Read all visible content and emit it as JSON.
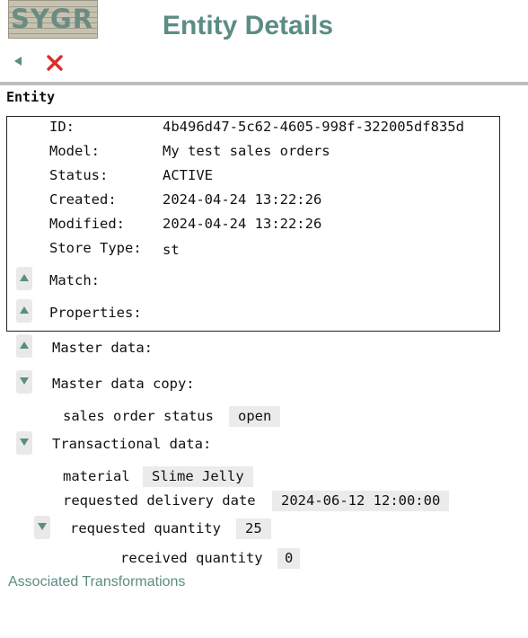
{
  "header": {
    "logo_text": "SYGR",
    "title": "Entity Details"
  },
  "toolbar": {
    "back_icon": "triangle-left-icon",
    "close_icon": "red-x-close-icon",
    "colors": {
      "close": "#e02a2a",
      "accent": "#5b8d83"
    }
  },
  "entity": {
    "heading": "Entity",
    "fields": [
      {
        "label": "ID:",
        "value": "4b496d47-5c62-4605-998f-322005df835d"
      },
      {
        "label": "Model:",
        "value": "My test sales orders"
      },
      {
        "label": "Status:",
        "value": "ACTIVE"
      },
      {
        "label": "Created:",
        "value": "2024-04-24 13:22:26"
      },
      {
        "label": "Modified:",
        "value": "2024-04-24 13:22:26"
      },
      {
        "label": "Store Type:",
        "value": "st"
      }
    ],
    "match_label": "Match:",
    "properties_label": "Properties:"
  },
  "master_data": {
    "label": "Master data:"
  },
  "master_data_copy": {
    "label": "Master data copy:",
    "items": [
      {
        "label": "sales order status",
        "value": "open"
      }
    ]
  },
  "transactional_data": {
    "label": "Transactional data:",
    "items": [
      {
        "label": "material",
        "value": "Slime Jelly"
      },
      {
        "label": "requested delivery date",
        "value": "2024-06-12 12:00:00"
      }
    ],
    "requested_quantity": {
      "label": "requested quantity",
      "value": "25",
      "received": {
        "label": "received quantity",
        "value": "0"
      }
    }
  },
  "footer": {
    "link": "Associated Transformations"
  }
}
